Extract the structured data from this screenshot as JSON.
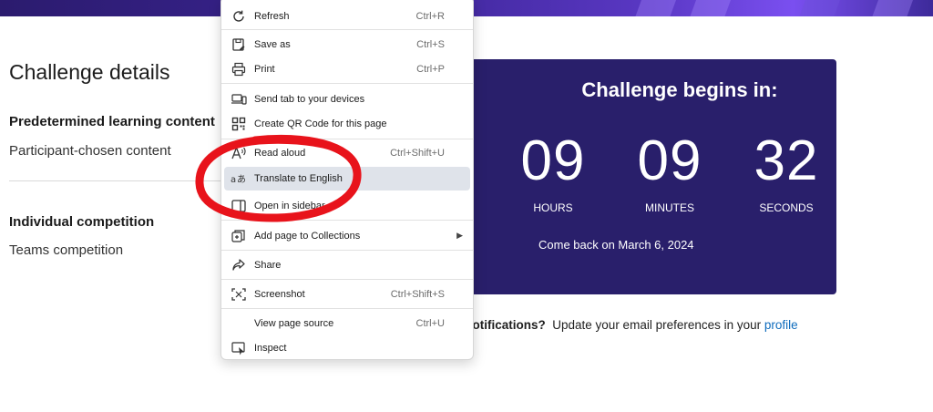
{
  "details": {
    "title": "Challenge details",
    "learning_label": "Predetermined learning content",
    "learning_value": "Participant-chosen content",
    "competition_label": "Individual competition",
    "competition_value": "Teams competition"
  },
  "countdown": {
    "title": "Challenge begins in:",
    "hours": "09",
    "hours_label": "HOURS",
    "minutes": "09",
    "minutes_label": "MINUTES",
    "seconds": "32",
    "seconds_label": "SECONDS",
    "come_back": "Come back on March 6, 2024"
  },
  "notifications": {
    "bold_text": "ng notifications?",
    "text": "Update your email preferences in your",
    "link": "profile"
  },
  "context_menu": {
    "items": [
      {
        "label": "Refresh",
        "shortcut": "Ctrl+R",
        "icon": "refresh-icon"
      },
      {
        "label": "Save as",
        "shortcut": "Ctrl+S",
        "icon": "save-as-icon"
      },
      {
        "label": "Print",
        "shortcut": "Ctrl+P",
        "icon": "print-icon"
      },
      {
        "label": "Send tab to your devices",
        "shortcut": "",
        "icon": "send-tab-icon"
      },
      {
        "label": "Create QR Code for this page",
        "shortcut": "",
        "icon": "qr-code-icon"
      },
      {
        "label": "Read aloud",
        "shortcut": "Ctrl+Shift+U",
        "icon": "read-aloud-icon"
      },
      {
        "label": "Translate to English",
        "shortcut": "",
        "icon": "translate-icon"
      },
      {
        "label": "Open in sidebar",
        "shortcut": "",
        "icon": "sidebar-icon"
      },
      {
        "label": "Add page to Collections",
        "shortcut": "",
        "icon": "collections-icon"
      },
      {
        "label": "Share",
        "shortcut": "",
        "icon": "share-icon"
      },
      {
        "label": "Screenshot",
        "shortcut": "Ctrl+Shift+S",
        "icon": "screenshot-icon"
      },
      {
        "label": "View page source",
        "shortcut": "Ctrl+U",
        "icon": ""
      },
      {
        "label": "Inspect",
        "shortcut": "",
        "icon": "inspect-icon"
      }
    ]
  },
  "colors": {
    "card_bg": "#291f6b",
    "highlight": "#dfe3ea",
    "annotation_red": "#e8131b",
    "link": "#0f6cbd"
  }
}
